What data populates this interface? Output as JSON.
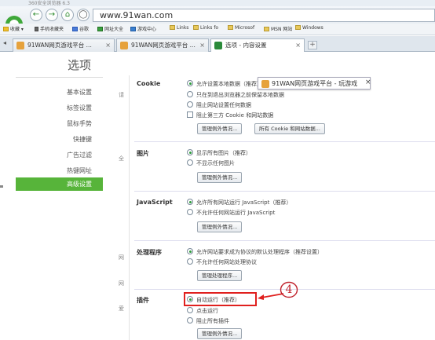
{
  "window": {
    "title": "360安全浏览器 6.3"
  },
  "nav": {
    "url": "www.91wan.com"
  },
  "bookmarks": [
    {
      "label": "收藏"
    },
    {
      "label": "手机收藏夹"
    },
    {
      "label": "谷歌"
    },
    {
      "label": "网址大全"
    },
    {
      "label": "游戏中心"
    },
    {
      "label": "Links"
    },
    {
      "label": "Links fo"
    },
    {
      "label": "Microsof"
    },
    {
      "label": "MSN 网站"
    },
    {
      "label": "Windows"
    }
  ],
  "tabs": [
    {
      "label": "91WAN网页游戏平台 ..."
    },
    {
      "label": "91WAN网页游戏平台 ..."
    },
    {
      "label": "选项 - 内容设置"
    }
  ],
  "page_title": "选项",
  "sidebar": {
    "items": [
      {
        "label": "基本设置"
      },
      {
        "label": "标签设置"
      },
      {
        "label": "鼠标手势"
      },
      {
        "label": "快捷键"
      },
      {
        "label": "广告过滤"
      },
      {
        "label": "热键网址"
      },
      {
        "label": "高级设置"
      }
    ]
  },
  "edge_labels": [
    "请",
    "全",
    "网",
    "网",
    "爱"
  ],
  "popup": {
    "text": "91WAN网页游戏平台 - 玩游戏"
  },
  "sections": {
    "cookie": {
      "title": "Cookie",
      "options": [
        "允许设置本地数据（推荐）",
        "只在到退出浏览器之前保留本地数据",
        "阻止网站设置任何数据",
        "阻止第三方 Cookie 和网站数据"
      ],
      "buttons": [
        "管理例外情况...",
        "所有 Cookie 和网站数据..."
      ]
    },
    "images": {
      "title": "图片",
      "options": [
        "显示所有图片（推荐）",
        "不显示任何图片"
      ],
      "buttons": [
        "管理例外情况..."
      ]
    },
    "javascript": {
      "title": "JavaScript",
      "options": [
        "允许所有网站运行 JavaScript（推荐）",
        "不允许任何网站运行 JavaScript"
      ],
      "buttons": [
        "管理例外情况..."
      ]
    },
    "handlers": {
      "title": "处理程序",
      "options": [
        "允许网站要求成为协议的默认处理程序（推荐设置）",
        "不允许任何网站处理协议"
      ],
      "buttons": [
        "管理处理程序..."
      ]
    },
    "plugins": {
      "title": "插件",
      "options": [
        "自动运行（推荐）",
        "点击运行",
        "阻止所有插件"
      ],
      "buttons": [
        "管理例外情况..."
      ]
    }
  },
  "annotation": {
    "number": "4"
  },
  "colors": {
    "accent_green": "#57b43a",
    "annotation_red": "#e0201e"
  }
}
